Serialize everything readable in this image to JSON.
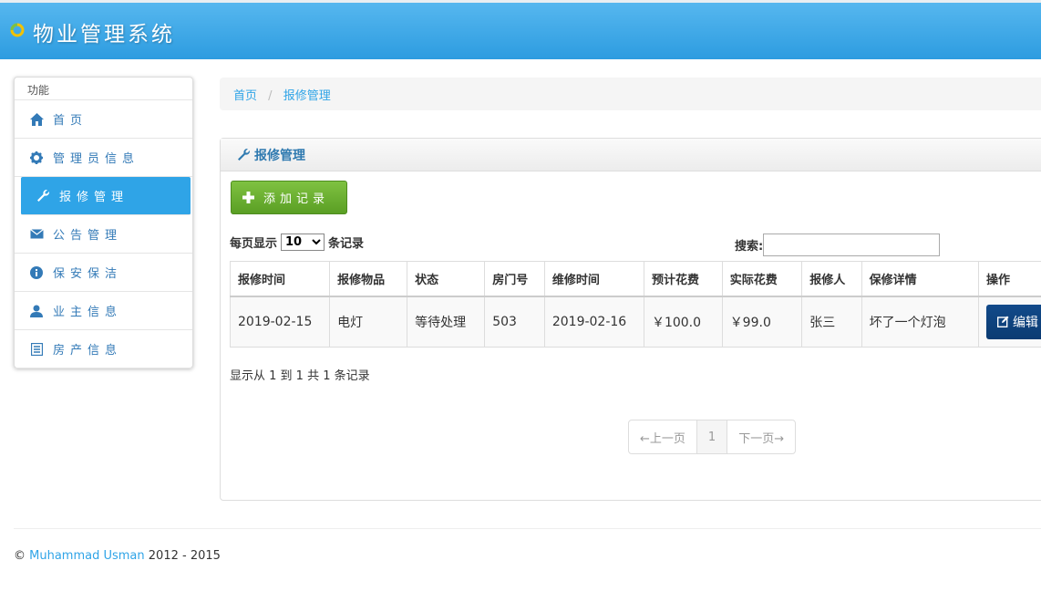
{
  "header": {
    "brand": "物业管理系统"
  },
  "sidebar": {
    "heading": "功能",
    "items": [
      {
        "label": "首页",
        "icon": "home-icon"
      },
      {
        "label": "管理员信息",
        "icon": "gear-icon"
      },
      {
        "label": "报修管理",
        "icon": "wrench-icon",
        "active": true
      },
      {
        "label": "公告管理",
        "icon": "envelope-icon"
      },
      {
        "label": "保安保洁",
        "icon": "info-icon"
      },
      {
        "label": "业主信息",
        "icon": "user-icon"
      },
      {
        "label": "房产信息",
        "icon": "list-icon"
      }
    ]
  },
  "breadcrumb": {
    "home": "首页",
    "sep": "/",
    "current": "报修管理"
  },
  "panel": {
    "title": "报修管理",
    "add_button": "添加记录",
    "length": {
      "prefix": "每页显示",
      "selected": "10",
      "suffix": "条记录"
    },
    "search_label": "搜索:",
    "columns": [
      "报修时间",
      "报修物品",
      "状态",
      "房门号",
      "维修时间",
      "预计花费",
      "实际花费",
      "报修人",
      "保修详情",
      "操作"
    ],
    "rows": [
      {
        "report_time": "2019-02-15",
        "item": "电灯",
        "status": "等待处理",
        "room": "503",
        "repair_time": "2019-02-16",
        "estimated_cost": "￥100.0",
        "actual_cost": "￥99.0",
        "reporter": "张三",
        "detail": "坏了一个灯泡",
        "action": "编辑"
      }
    ],
    "info": "显示从 1 到 1 共 1 条记录",
    "pager": {
      "prev": "←上一页",
      "page": "1",
      "next": "下一页→"
    }
  },
  "footer": {
    "copyright": "©",
    "author": "Muhammad Usman",
    "years": "2012 - 2015"
  },
  "colors": {
    "header": "#2d9ce0",
    "active": "#2fa4e7",
    "add_button": "#6fb233",
    "edit_button": "#0b3b72"
  }
}
